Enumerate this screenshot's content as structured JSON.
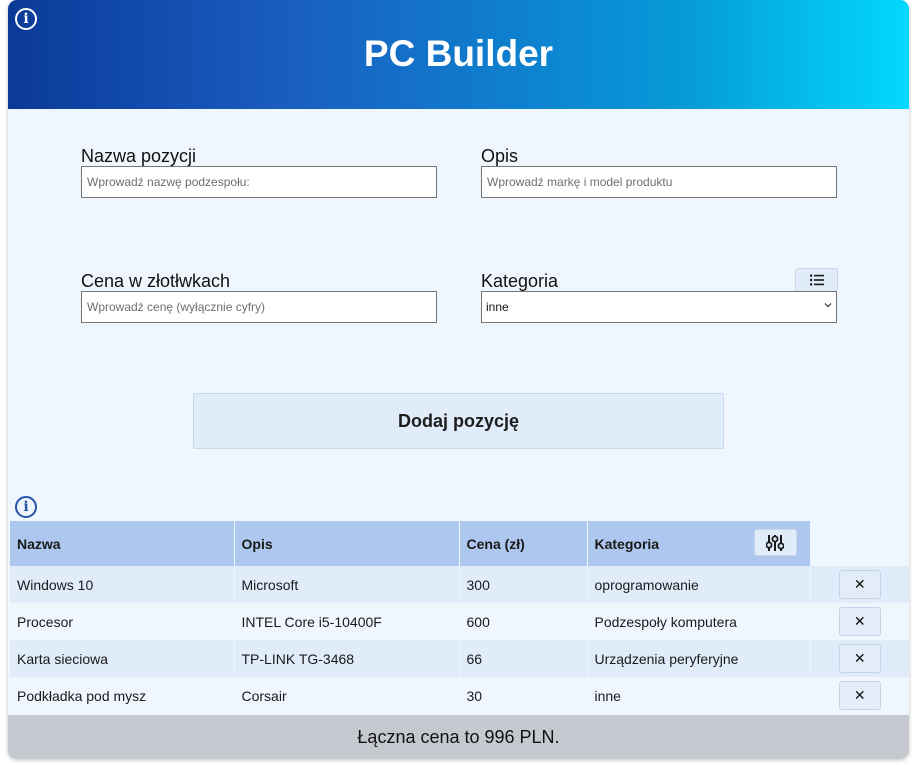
{
  "header": {
    "title": "PC Builder",
    "info_icon": "info-icon"
  },
  "form": {
    "name": {
      "label": "Nazwa pozycji",
      "placeholder": "Wprowadź nazwę podzespołu:",
      "value": ""
    },
    "description": {
      "label": "Opis",
      "placeholder": "Wprowadź markę i model produktu",
      "value": ""
    },
    "price": {
      "label": "Cena w złotłwkach",
      "placeholder": "Wprowadź cenę (wyłącznie cyfry)",
      "value": ""
    },
    "category": {
      "label": "Kategoria",
      "selected": "inne",
      "manage_icon": "list-icon"
    },
    "add_button": "Dodaj pozycję"
  },
  "table": {
    "info_icon": "info-icon",
    "headers": [
      "Nazwa",
      "Opis",
      "Cena (zł)",
      "Kategoria"
    ],
    "filter_icon": "sliders-icon",
    "delete_label": "✕",
    "rows": [
      {
        "name": "Windows 10",
        "description": "Microsoft",
        "price": "300",
        "category": "oprogramowanie"
      },
      {
        "name": "Procesor",
        "description": "INTEL Core i5-10400F",
        "price": "600",
        "category": "Podzespoły komputera"
      },
      {
        "name": "Karta sieciowa",
        "description": "TP-LINK TG-3468",
        "price": "66",
        "category": "Urządzenia peryferyjne"
      },
      {
        "name": "Podkładka pod mysz",
        "description": "Corsair",
        "price": "30",
        "category": "inne"
      }
    ]
  },
  "footer": {
    "total_text": "Łączna cena to 996 PLN."
  },
  "colors": {
    "header_gradient_start": "#0a3a98",
    "header_gradient_end": "#02d8fd",
    "table_header": "#adc7ee",
    "row_odd": "#e1ecfb",
    "row_even": "#eff6fe",
    "footer_bg": "#c5c9cf",
    "page_bg": "#eff6fe"
  }
}
